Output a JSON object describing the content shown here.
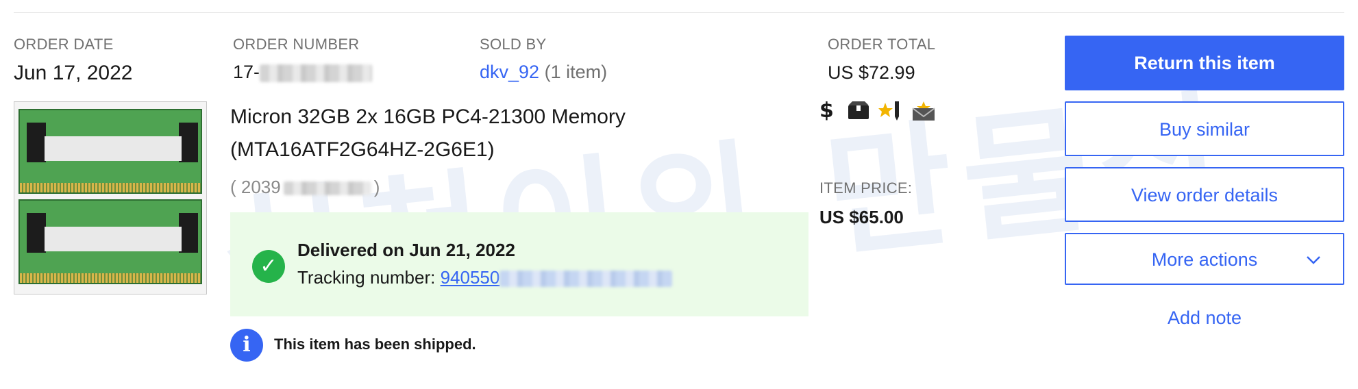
{
  "order": {
    "date_label": "ORDER DATE",
    "date_value": "Jun 17, 2022",
    "number_label": "ORDER NUMBER",
    "number_prefix": "17-",
    "sold_by_label": "SOLD BY",
    "seller_name": "dkv_92",
    "seller_item_count": "(1 item)",
    "total_label": "ORDER TOTAL",
    "total_value": "US $72.99"
  },
  "item": {
    "title_line1": "Micron 32GB 2x 16GB PC4-21300 Memory",
    "title_line2": "(MTA16ATF2G64HZ-2G6E1)",
    "id_open": "( 2039",
    "id_close": ")",
    "price_label": "ITEM PRICE:",
    "price_value": "US $65.00"
  },
  "delivery": {
    "status": "Delivered on Jun 21, 2022",
    "tracking_label": "Tracking number:",
    "tracking_prefix": "940550"
  },
  "notice": {
    "text": "This item has been shipped."
  },
  "status_icons": [
    "dollar-icon",
    "package-icon",
    "star-feedback-icon",
    "mail-icon"
  ],
  "actions": {
    "return": "Return this item",
    "buy_similar": "Buy similar",
    "view_details": "View order details",
    "more_actions": "More actions",
    "add_note": "Add note"
  },
  "watermark_text": "심천이의 만물상",
  "colors": {
    "accent": "#3665f3",
    "delivered_bg": "#ebfbe8",
    "success": "#25b34a"
  }
}
